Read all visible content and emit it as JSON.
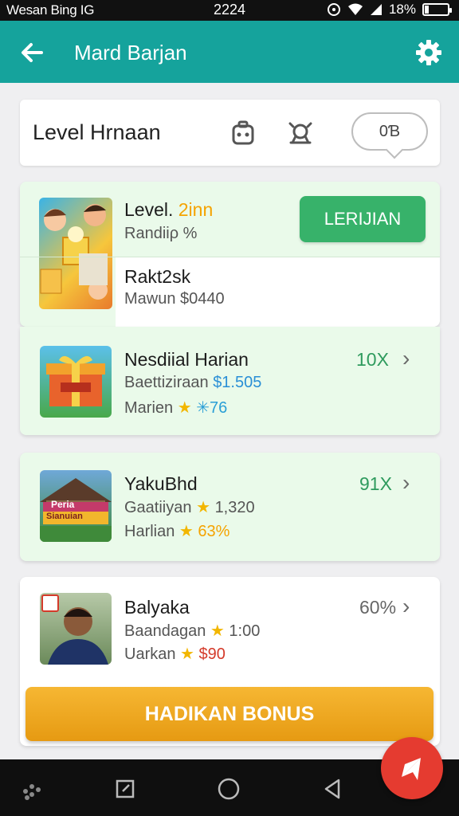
{
  "status_bar": {
    "left_text": "Wesan Bing IG",
    "time": "2224",
    "battery": "18%",
    "battery_fraction": 0.18
  },
  "app_bar": {
    "title": "Mard Barjan",
    "back_icon": "back-arrow-icon",
    "settings_icon": "gear-icon"
  },
  "level_header": {
    "label": "Level Hrnaan",
    "icons": [
      "robot-icon",
      "bot-icon"
    ],
    "pill_value": "0Ɓ"
  },
  "items": [
    {
      "title_prefix": "Level.",
      "title_accent": "2inn",
      "subtitle": "Randiiρ %",
      "button_label": "LERIJIAN",
      "second_title": "Rakt2sk",
      "second_sub": "Mawun $0440"
    },
    {
      "title": "Nesdiial Harian",
      "line1_label": "Baettiziraan",
      "line1_value": "$1.505",
      "line2_label": "Marien",
      "line2_value": "✳76",
      "percent": "10X"
    },
    {
      "title": "YakuBhd",
      "line1_label": "Gaatiiyan",
      "line1_value": "1,320",
      "line2_label": "Harlian",
      "line2_value": "63%",
      "percent": "91X",
      "thumb_text_top": "Peria",
      "thumb_text_bottom": "Sianuian"
    },
    {
      "title": "Balyaka",
      "line1_label": "Baandagan",
      "line1_value": "1:00",
      "line2_label": "Uarkan",
      "line2_value": "$90",
      "percent": "60%"
    }
  ],
  "bonus_button": "HADIKAN BONUS",
  "colors": {
    "app_bar": "#15a39c",
    "green_button": "#37b26a",
    "accent_orange": "#f5a300",
    "bonus": "#f0a920",
    "fab": "#e53b30"
  }
}
